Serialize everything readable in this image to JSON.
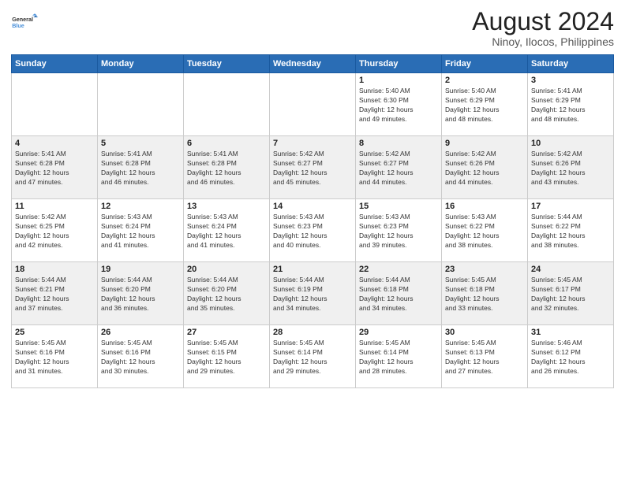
{
  "logo": {
    "line1": "General",
    "line2": "Blue"
  },
  "title": "August 2024",
  "location": "Ninoy, Ilocos, Philippines",
  "days_header": [
    "Sunday",
    "Monday",
    "Tuesday",
    "Wednesday",
    "Thursday",
    "Friday",
    "Saturday"
  ],
  "weeks": [
    [
      {
        "day": "",
        "info": ""
      },
      {
        "day": "",
        "info": ""
      },
      {
        "day": "",
        "info": ""
      },
      {
        "day": "",
        "info": ""
      },
      {
        "day": "1",
        "info": "Sunrise: 5:40 AM\nSunset: 6:30 PM\nDaylight: 12 hours\nand 49 minutes."
      },
      {
        "day": "2",
        "info": "Sunrise: 5:40 AM\nSunset: 6:29 PM\nDaylight: 12 hours\nand 48 minutes."
      },
      {
        "day": "3",
        "info": "Sunrise: 5:41 AM\nSunset: 6:29 PM\nDaylight: 12 hours\nand 48 minutes."
      }
    ],
    [
      {
        "day": "4",
        "info": "Sunrise: 5:41 AM\nSunset: 6:28 PM\nDaylight: 12 hours\nand 47 minutes."
      },
      {
        "day": "5",
        "info": "Sunrise: 5:41 AM\nSunset: 6:28 PM\nDaylight: 12 hours\nand 46 minutes."
      },
      {
        "day": "6",
        "info": "Sunrise: 5:41 AM\nSunset: 6:28 PM\nDaylight: 12 hours\nand 46 minutes."
      },
      {
        "day": "7",
        "info": "Sunrise: 5:42 AM\nSunset: 6:27 PM\nDaylight: 12 hours\nand 45 minutes."
      },
      {
        "day": "8",
        "info": "Sunrise: 5:42 AM\nSunset: 6:27 PM\nDaylight: 12 hours\nand 44 minutes."
      },
      {
        "day": "9",
        "info": "Sunrise: 5:42 AM\nSunset: 6:26 PM\nDaylight: 12 hours\nand 44 minutes."
      },
      {
        "day": "10",
        "info": "Sunrise: 5:42 AM\nSunset: 6:26 PM\nDaylight: 12 hours\nand 43 minutes."
      }
    ],
    [
      {
        "day": "11",
        "info": "Sunrise: 5:42 AM\nSunset: 6:25 PM\nDaylight: 12 hours\nand 42 minutes."
      },
      {
        "day": "12",
        "info": "Sunrise: 5:43 AM\nSunset: 6:24 PM\nDaylight: 12 hours\nand 41 minutes."
      },
      {
        "day": "13",
        "info": "Sunrise: 5:43 AM\nSunset: 6:24 PM\nDaylight: 12 hours\nand 41 minutes."
      },
      {
        "day": "14",
        "info": "Sunrise: 5:43 AM\nSunset: 6:23 PM\nDaylight: 12 hours\nand 40 minutes."
      },
      {
        "day": "15",
        "info": "Sunrise: 5:43 AM\nSunset: 6:23 PM\nDaylight: 12 hours\nand 39 minutes."
      },
      {
        "day": "16",
        "info": "Sunrise: 5:43 AM\nSunset: 6:22 PM\nDaylight: 12 hours\nand 38 minutes."
      },
      {
        "day": "17",
        "info": "Sunrise: 5:44 AM\nSunset: 6:22 PM\nDaylight: 12 hours\nand 38 minutes."
      }
    ],
    [
      {
        "day": "18",
        "info": "Sunrise: 5:44 AM\nSunset: 6:21 PM\nDaylight: 12 hours\nand 37 minutes."
      },
      {
        "day": "19",
        "info": "Sunrise: 5:44 AM\nSunset: 6:20 PM\nDaylight: 12 hours\nand 36 minutes."
      },
      {
        "day": "20",
        "info": "Sunrise: 5:44 AM\nSunset: 6:20 PM\nDaylight: 12 hours\nand 35 minutes."
      },
      {
        "day": "21",
        "info": "Sunrise: 5:44 AM\nSunset: 6:19 PM\nDaylight: 12 hours\nand 34 minutes."
      },
      {
        "day": "22",
        "info": "Sunrise: 5:44 AM\nSunset: 6:18 PM\nDaylight: 12 hours\nand 34 minutes."
      },
      {
        "day": "23",
        "info": "Sunrise: 5:45 AM\nSunset: 6:18 PM\nDaylight: 12 hours\nand 33 minutes."
      },
      {
        "day": "24",
        "info": "Sunrise: 5:45 AM\nSunset: 6:17 PM\nDaylight: 12 hours\nand 32 minutes."
      }
    ],
    [
      {
        "day": "25",
        "info": "Sunrise: 5:45 AM\nSunset: 6:16 PM\nDaylight: 12 hours\nand 31 minutes."
      },
      {
        "day": "26",
        "info": "Sunrise: 5:45 AM\nSunset: 6:16 PM\nDaylight: 12 hours\nand 30 minutes."
      },
      {
        "day": "27",
        "info": "Sunrise: 5:45 AM\nSunset: 6:15 PM\nDaylight: 12 hours\nand 29 minutes."
      },
      {
        "day": "28",
        "info": "Sunrise: 5:45 AM\nSunset: 6:14 PM\nDaylight: 12 hours\nand 29 minutes."
      },
      {
        "day": "29",
        "info": "Sunrise: 5:45 AM\nSunset: 6:14 PM\nDaylight: 12 hours\nand 28 minutes."
      },
      {
        "day": "30",
        "info": "Sunrise: 5:45 AM\nSunset: 6:13 PM\nDaylight: 12 hours\nand 27 minutes."
      },
      {
        "day": "31",
        "info": "Sunrise: 5:46 AM\nSunset: 6:12 PM\nDaylight: 12 hours\nand 26 minutes."
      }
    ]
  ]
}
